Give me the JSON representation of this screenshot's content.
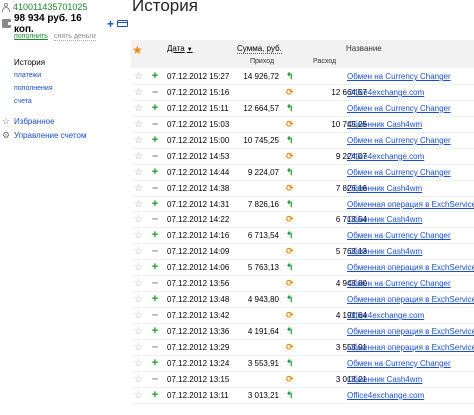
{
  "sidebar": {
    "account_number": "410011435701025",
    "balance": "98 934 руб. 16 коп.",
    "plus": "+",
    "topup": "пополнить",
    "withdraw": "снять деньги",
    "nav": [
      {
        "label": "История",
        "active": true
      },
      {
        "label": "платежи",
        "active": false
      },
      {
        "label": "пополнения",
        "active": false
      },
      {
        "label": "счета",
        "active": false
      }
    ],
    "tools": [
      {
        "label": "Избранное",
        "icon": "star-outline-icon",
        "glyph": "☆"
      },
      {
        "label": "Управление счетом",
        "icon": "gear-icon",
        "glyph": "⚙"
      }
    ]
  },
  "main": {
    "title": "История",
    "header": {
      "star": "★",
      "date": "Дата",
      "sort_arrow": "▼",
      "sum": "Сумма, руб.",
      "in": "Приход",
      "out": "Расход",
      "name": "Название"
    },
    "rows": [
      {
        "date": "07.12.2012 15:27",
        "type": "in",
        "in": "14 926,72",
        "out": "",
        "status": "green",
        "name": "Обмен на Currency Changer"
      },
      {
        "date": "07.12.2012 15:16",
        "type": "out",
        "in": "",
        "out": "12 664,57",
        "status": "orange",
        "name": "Office4exchange.com"
      },
      {
        "date": "07.12.2012 15:11",
        "type": "in",
        "in": "12 664,57",
        "out": "",
        "status": "green",
        "name": "Обмен на Currency Changer"
      },
      {
        "date": "07.12.2012 15:03",
        "type": "out",
        "in": "",
        "out": "10 745,25",
        "status": "orange",
        "name": "Обменник Cash4wm"
      },
      {
        "date": "07.12.2012 15:00",
        "type": "in",
        "in": "10 745,25",
        "out": "",
        "status": "green",
        "name": "Обмен на Currency Changer"
      },
      {
        "date": "07.12.2012 14:53",
        "type": "out",
        "in": "",
        "out": "9 224,07",
        "status": "orange",
        "name": "Office4exchange.com"
      },
      {
        "date": "07.12.2012 14:44",
        "type": "in",
        "in": "9 224,07",
        "out": "",
        "status": "green",
        "name": "Обмен на Currency Changer"
      },
      {
        "date": "07.12.2012 14:38",
        "type": "out",
        "in": "",
        "out": "7 826,16",
        "status": "orange",
        "name": "Обменник Cash4wm"
      },
      {
        "date": "07.12.2012 14:31",
        "type": "in",
        "in": "7 826,16",
        "out": "",
        "status": "green",
        "name": "Обменная операция в ExchService"
      },
      {
        "date": "07.12.2012 14:22",
        "type": "out",
        "in": "",
        "out": "6 713,54",
        "status": "orange",
        "name": "Обменник Cash4wm"
      },
      {
        "date": "07.12.2012 14:16",
        "type": "in",
        "in": "6 713,54",
        "out": "",
        "status": "green",
        "name": "Обмен на Currency Changer"
      },
      {
        "date": "07.12.2012 14:09",
        "type": "out",
        "in": "",
        "out": "5 763,13",
        "status": "orange",
        "name": "Обменник Cash4wm"
      },
      {
        "date": "07.12.2012 14:06",
        "type": "in",
        "in": "5 763,13",
        "out": "",
        "status": "green",
        "name": "Обменная операция в ExchService"
      },
      {
        "date": "07.12.2012 13:56",
        "type": "out",
        "in": "",
        "out": "4 943,80",
        "status": "orange",
        "name": "Обмен на Currency Changer"
      },
      {
        "date": "07.12.2012 13:48",
        "type": "in",
        "in": "4 943,80",
        "out": "",
        "status": "green",
        "name": "Обменная операция в ExchService"
      },
      {
        "date": "07.12.2012 13:42",
        "type": "out",
        "in": "",
        "out": "4 191,64",
        "status": "orange",
        "name": "Office4exchange.com"
      },
      {
        "date": "07.12.2012 13:36",
        "type": "in",
        "in": "4 191,64",
        "out": "",
        "status": "green",
        "name": "Обменная операция в ExchService"
      },
      {
        "date": "07.12.2012 13:29",
        "type": "out",
        "in": "",
        "out": "3 553,91",
        "status": "orange",
        "name": "Обменная операция в ExchService"
      },
      {
        "date": "07.12.2012 13:24",
        "type": "in",
        "in": "3 553,91",
        "out": "",
        "status": "green",
        "name": "Обмен на Currency Changer"
      },
      {
        "date": "07.12.2012 13:15",
        "type": "out",
        "in": "",
        "out": "3 013,21",
        "status": "orange",
        "name": "Обменник Cash4wm"
      },
      {
        "date": "07.12.2012 13:11",
        "type": "in",
        "in": "3 013,21",
        "out": "",
        "status": "green",
        "name": "Office4exchange.com"
      }
    ]
  },
  "colors": {
    "link": "#1a4fc8",
    "income": "#1a9a2a",
    "pending": "#ef8a12",
    "favorite": "#f08a10"
  }
}
